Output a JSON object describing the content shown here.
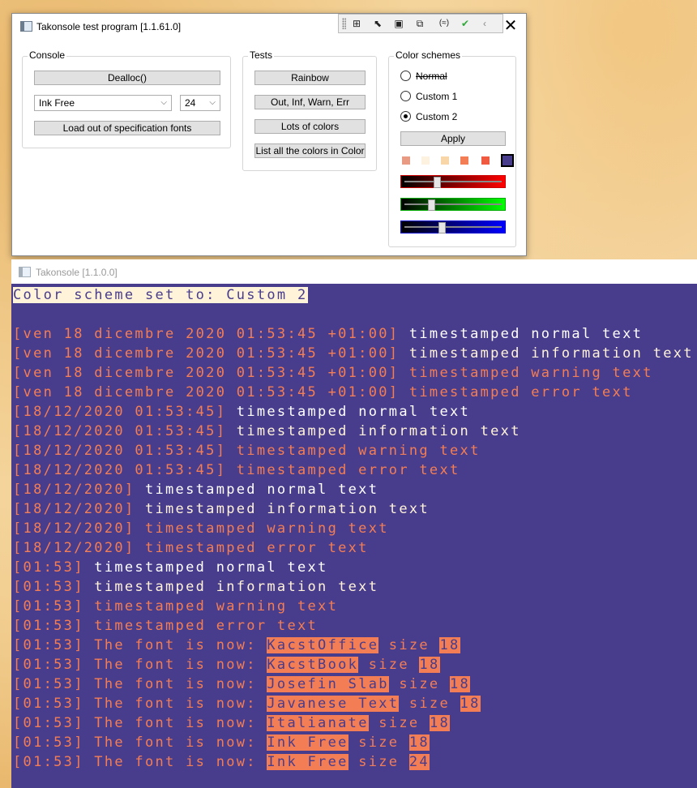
{
  "test_window": {
    "title": "Takonsole test program [1.1.61.0]",
    "close_glyph": "✕",
    "console_group": {
      "legend": "Console",
      "dealloc_label": "Dealloc()",
      "font_combo_value": "Ink Free",
      "size_combo_value": "24",
      "load_fonts_label": "Load out of specification fonts"
    },
    "tests_group": {
      "legend": "Tests",
      "buttons": [
        "Rainbow",
        "Out, Inf, Warn, Err",
        "Lots of colors",
        "List all the colors in Color"
      ]
    },
    "color_schemes_group": {
      "legend": "Color schemes",
      "options": [
        "Normal",
        "Custom 1",
        "Custom 2"
      ],
      "selected": "Custom 2",
      "apply_label": "Apply",
      "swatches": [
        "#e89a82",
        "#fdf2e0",
        "#f9d6a8",
        "#f37e55",
        "#f05a40",
        "#483c8c"
      ],
      "sliders": [
        {
          "channel": "red",
          "value": 0.34
        },
        {
          "channel": "green",
          "value": 0.28
        },
        {
          "channel": "blue",
          "value": 0.39
        }
      ]
    }
  },
  "console_window": {
    "title": "Takonsole [1.1.0.0]",
    "colors": {
      "background": "#483c8c",
      "normal": "#ffffff",
      "information": "#fff3da",
      "warning": "#f37e55",
      "error": "#f37e55"
    },
    "lines": [
      {
        "segments": [
          {
            "text": "Color scheme set to: Custom 2",
            "style": "hl-notice"
          }
        ]
      },
      {
        "segments": [
          {
            "text": "",
            "style": "c-white"
          }
        ]
      },
      {
        "segments": [
          {
            "text": "[ven 18 dicembre 2020 01:53:45 +01:00] ",
            "style": "c-orange"
          },
          {
            "text": "timestamped normal text",
            "style": "c-white"
          }
        ]
      },
      {
        "segments": [
          {
            "text": "[ven 18 dicembre 2020 01:53:45 +01:00] ",
            "style": "c-orange"
          },
          {
            "text": "timestamped information text",
            "style": "c-cream"
          }
        ]
      },
      {
        "segments": [
          {
            "text": "[ven 18 dicembre 2020 01:53:45 +01:00] timestamped warning text",
            "style": "c-orange"
          }
        ]
      },
      {
        "segments": [
          {
            "text": "[ven 18 dicembre 2020 01:53:45 +01:00] timestamped error text",
            "style": "c-orange"
          }
        ]
      },
      {
        "segments": [
          {
            "text": "[18/12/2020 01:53:45] ",
            "style": "c-orange"
          },
          {
            "text": "timestamped normal text",
            "style": "c-white"
          }
        ]
      },
      {
        "segments": [
          {
            "text": "[18/12/2020 01:53:45] ",
            "style": "c-orange"
          },
          {
            "text": "timestamped information text",
            "style": "c-cream"
          }
        ]
      },
      {
        "segments": [
          {
            "text": "[18/12/2020 01:53:45] timestamped warning text",
            "style": "c-orange"
          }
        ]
      },
      {
        "segments": [
          {
            "text": "[18/12/2020 01:53:45] timestamped error text",
            "style": "c-orange"
          }
        ]
      },
      {
        "segments": [
          {
            "text": "[18/12/2020] ",
            "style": "c-orange"
          },
          {
            "text": "timestamped normal text",
            "style": "c-white"
          }
        ]
      },
      {
        "segments": [
          {
            "text": "[18/12/2020] ",
            "style": "c-orange"
          },
          {
            "text": "timestamped information text",
            "style": "c-cream"
          }
        ]
      },
      {
        "segments": [
          {
            "text": "[18/12/2020] timestamped warning text",
            "style": "c-orange"
          }
        ]
      },
      {
        "segments": [
          {
            "text": "[18/12/2020] timestamped error text",
            "style": "c-orange"
          }
        ]
      },
      {
        "segments": [
          {
            "text": "[01:53] ",
            "style": "c-orange"
          },
          {
            "text": "timestamped normal text",
            "style": "c-white"
          }
        ]
      },
      {
        "segments": [
          {
            "text": "[01:53] ",
            "style": "c-orange"
          },
          {
            "text": "timestamped information text",
            "style": "c-cream"
          }
        ]
      },
      {
        "segments": [
          {
            "text": "[01:53] timestamped warning text",
            "style": "c-orange"
          }
        ]
      },
      {
        "segments": [
          {
            "text": "[01:53] timestamped error text",
            "style": "c-orange"
          }
        ]
      },
      {
        "segments": [
          {
            "text": "[01:53] The font is now: ",
            "style": "c-orange"
          },
          {
            "text": "KacstOffice",
            "style": "hl-orange"
          },
          {
            "text": " size ",
            "style": "c-orange"
          },
          {
            "text": "18",
            "style": "hl-orange"
          }
        ]
      },
      {
        "segments": [
          {
            "text": "[01:53] The font is now: ",
            "style": "c-orange"
          },
          {
            "text": "KacstBook",
            "style": "hl-orange"
          },
          {
            "text": " size ",
            "style": "c-orange"
          },
          {
            "text": "18",
            "style": "hl-orange"
          }
        ]
      },
      {
        "segments": [
          {
            "text": "[01:53] The font is now: ",
            "style": "c-orange"
          },
          {
            "text": "Josefin Slab",
            "style": "hl-orange"
          },
          {
            "text": " size ",
            "style": "c-orange"
          },
          {
            "text": "18",
            "style": "hl-orange"
          }
        ]
      },
      {
        "segments": [
          {
            "text": "[01:53] The font is now: ",
            "style": "c-orange"
          },
          {
            "text": "Javanese Text",
            "style": "hl-orange"
          },
          {
            "text": " size ",
            "style": "c-orange"
          },
          {
            "text": "18",
            "style": "hl-orange"
          }
        ]
      },
      {
        "segments": [
          {
            "text": "[01:53] The font is now: ",
            "style": "c-orange"
          },
          {
            "text": "Italianate",
            "style": "hl-orange"
          },
          {
            "text": " size ",
            "style": "c-orange"
          },
          {
            "text": "18",
            "style": "hl-orange"
          }
        ]
      },
      {
        "segments": [
          {
            "text": "[01:53] The font is now: ",
            "style": "c-orange"
          },
          {
            "text": "Ink Free",
            "style": "hl-orange"
          },
          {
            "text": " size ",
            "style": "c-orange"
          },
          {
            "text": "18",
            "style": "hl-orange"
          }
        ]
      },
      {
        "segments": [
          {
            "text": "[01:53] The font is now: ",
            "style": "c-orange"
          },
          {
            "text": "Ink Free",
            "style": "hl-orange"
          },
          {
            "text": " size ",
            "style": "c-orange"
          },
          {
            "text": "24",
            "style": "hl-orange"
          }
        ]
      }
    ]
  }
}
